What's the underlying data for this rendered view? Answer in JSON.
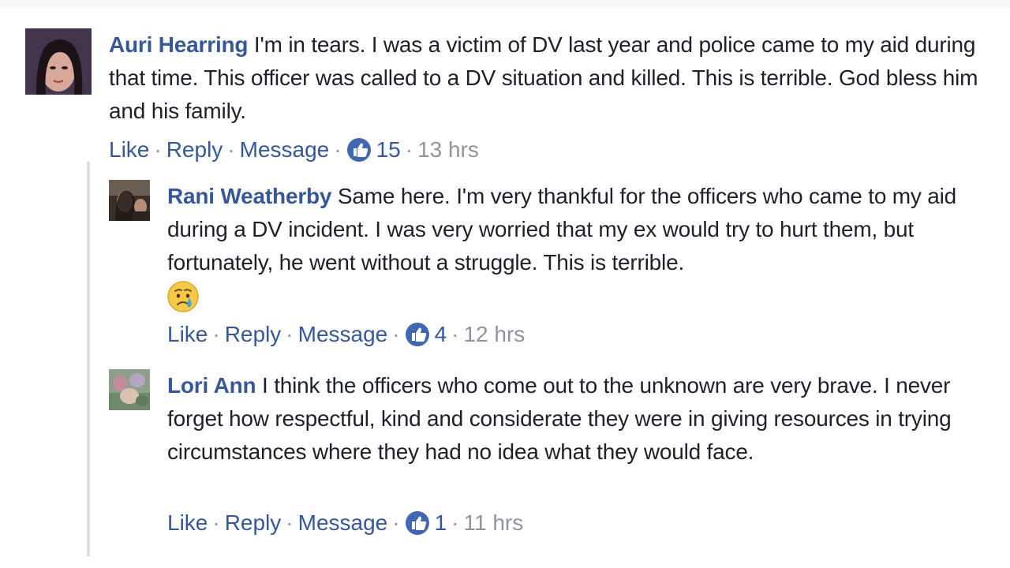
{
  "colors": {
    "author": "#365899",
    "text": "#1d2129",
    "meta": "#90949c",
    "like_badge": "#4267b2",
    "rail": "#dddfe2"
  },
  "comments": [
    {
      "author": "Auri Hearring",
      "text": "I'm in tears. I was a victim of DV last year and police came to my aid during that time. This officer was called to a DV situation and killed. This is terrible. God bless him and his family.",
      "actions": {
        "like": "Like",
        "reply": "Reply",
        "message": "Message"
      },
      "like_count": "15",
      "time": "13 hrs",
      "avatar_icon": "profile-photo"
    },
    {
      "author": "Rani Weatherby",
      "text": "Same here. I'm very thankful for the officers who came to my aid during a DV incident. I was very worried that my ex would try to hurt them, but fortunately, he went without a struggle. This is terrible.",
      "emoji": "crying-face-icon",
      "actions": {
        "like": "Like",
        "reply": "Reply",
        "message": "Message"
      },
      "like_count": "4",
      "time": "12 hrs",
      "avatar_icon": "profile-photo"
    },
    {
      "author": "Lori Ann",
      "text": "I think the officers who come out to the unknown are very brave. I never forget how respectful, kind and considerate they were in giving resources in trying circumstances where they had no idea what they would face.",
      "actions": {
        "like": "Like",
        "reply": "Reply",
        "message": "Message"
      },
      "like_count": "1",
      "time": "11 hrs",
      "avatar_icon": "profile-photo"
    }
  ]
}
